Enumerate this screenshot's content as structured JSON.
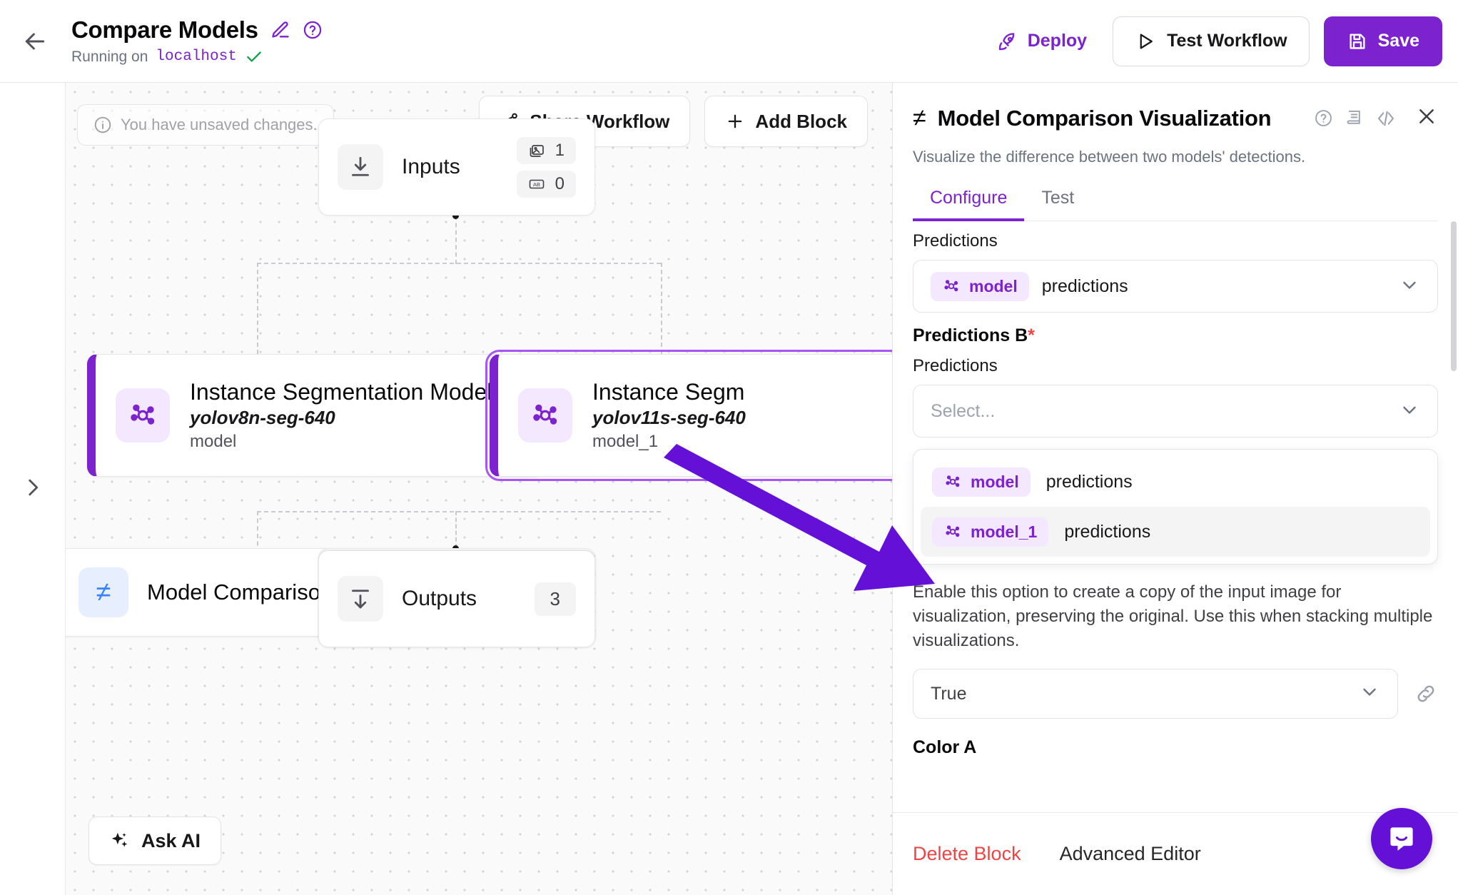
{
  "header": {
    "back_icon": "arrow-left-icon",
    "workflow_title": "Compare Models",
    "edit_icon": "pencil-icon",
    "help_icon": "help-circle-icon",
    "running_prefix": "Running on",
    "running_host": "localhost",
    "status_icon": "check-icon",
    "deploy_label": "Deploy",
    "deploy_icon": "rocket-icon",
    "test_label": "Test Workflow",
    "test_icon": "play-icon",
    "save_label": "Save",
    "save_icon": "save-disk-icon",
    "accent": "#7c22ce"
  },
  "left_rail": {
    "expand_icon": "chevron-right-icon"
  },
  "canvas": {
    "unsaved_notice": "You have unsaved changes.",
    "unsaved_icon": "info-circle-icon",
    "share_label": "Share Workflow",
    "share_icon": "share-nodes-icon",
    "add_block_label": "Add Block",
    "add_block_icon": "plus-icon",
    "ask_ai_label": "Ask AI",
    "ask_ai_icon": "sparkles-icon",
    "nodes": {
      "inputs": {
        "label": "Inputs",
        "icon": "download-into-line-icon",
        "badges": [
          {
            "icon": "image-icon",
            "count": "1"
          },
          {
            "icon": "ab-text-icon",
            "count": "0"
          }
        ]
      },
      "model_a": {
        "title": "Instance Segmentation Model",
        "subtitle": "yolov8n-seg-640",
        "variable": "model",
        "icon": "model-graph-icon",
        "accent": "#7c22ce"
      },
      "model_b": {
        "title": "Instance Segm",
        "subtitle": "yolov11s-seg-640",
        "variable": "model_1",
        "icon": "model-graph-icon",
        "accent": "#7c22ce",
        "selected": true
      },
      "visualization": {
        "title": "Model Comparison Visualization",
        "icon": "not-equal-icon",
        "warning_icon": "warning-triangle-icon",
        "accent": "#2563eb"
      },
      "outputs": {
        "label": "Outputs",
        "icon": "download-out-line-icon",
        "count": "3"
      }
    }
  },
  "panel": {
    "block_icon": "not-equal-icon",
    "title": "Model Comparison Visualization",
    "header_icons": [
      {
        "name": "help-circle-icon"
      },
      {
        "name": "docs-book-icon"
      },
      {
        "name": "code-brackets-icon"
      }
    ],
    "close_icon": "close-icon",
    "description": "Visualize the difference between two models' detections.",
    "tabs": [
      {
        "label": "Configure",
        "active": true
      },
      {
        "label": "Test",
        "active": false
      }
    ],
    "fields": {
      "predictions_a": {
        "label": "Predictions",
        "chip_label": "model",
        "chip_icon": "model-graph-icon",
        "value": "predictions",
        "caret_icon": "chevron-down-icon"
      },
      "predictions_b": {
        "group_label": "Predictions B",
        "required_marker": "*",
        "label": "Predictions",
        "placeholder": "Select...",
        "caret_icon": "chevron-down-icon",
        "options": [
          {
            "chip_label": "model",
            "chip_icon": "model-graph-icon",
            "text": "predictions",
            "highlighted": false
          },
          {
            "chip_label": "model_1",
            "chip_icon": "model-graph-icon",
            "text": "predictions",
            "highlighted": true
          }
        ]
      },
      "copy_image": {
        "helper": "Enable this option to create a copy of the input image for visualization, preserving the original. Use this when stacking multiple visualizations.",
        "value": "True",
        "caret_icon": "chevron-down-icon",
        "link_icon": "link-chain-icon"
      },
      "color_a": {
        "label": "Color A"
      }
    },
    "footer": {
      "delete_label": "Delete Block",
      "advanced_label": "Advanced Editor",
      "delete_color": "#ef4444"
    }
  },
  "annotation": {
    "arrow_color": "#6410d6",
    "arrow_from": "model_1 node",
    "arrow_to": "model_1 predictions option"
  },
  "support": {
    "icon": "intercom-chat-icon",
    "color": "#6410d6"
  }
}
